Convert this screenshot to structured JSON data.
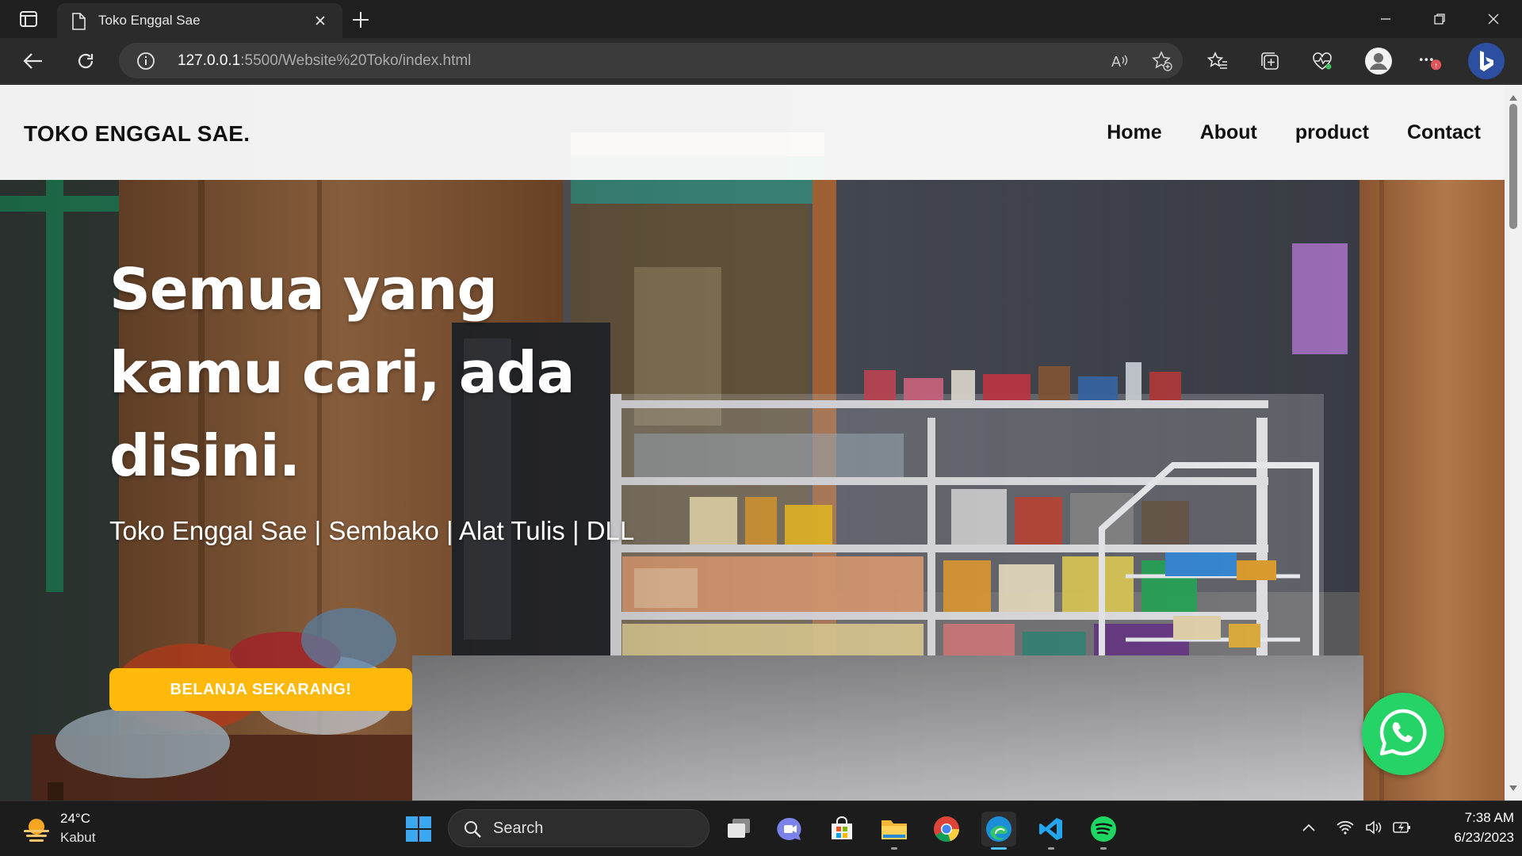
{
  "browser": {
    "tab_title": "Toko Enggal Sae",
    "url_host": "127.0.0.1",
    "url_rest": ":5500/Website%20Toko/index.html"
  },
  "site": {
    "brand": "TOKO ENGGAL SAE.",
    "nav": [
      "Home",
      "About",
      "product",
      "Contact"
    ],
    "hero": {
      "title": "Semua yang kamu cari, ada disini.",
      "subtitle": "Toko Enggal Sae | Sembako | Alat Tulis | DLL",
      "cta": "BELANJA SEKARANG!"
    },
    "colors": {
      "cta": "#ffb90a",
      "whatsapp": "#25d366"
    }
  },
  "taskbar": {
    "weather": {
      "temp": "24°C",
      "condition": "Kabut"
    },
    "search_label": "Search",
    "time": "7:38 AM",
    "date": "6/23/2023",
    "pinned_icons": [
      "windows-start-icon",
      "task-view-icon",
      "teams-chat-icon",
      "microsoft-store-icon",
      "file-explorer-icon",
      "chrome-icon",
      "edge-icon",
      "vscode-icon",
      "spotify-icon"
    ]
  }
}
